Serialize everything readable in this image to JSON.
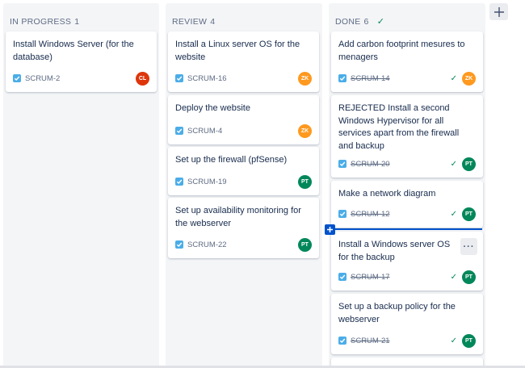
{
  "columns": [
    {
      "name": "IN PROGRESS",
      "count": "1",
      "done": false
    },
    {
      "name": "REVIEW",
      "count": "4",
      "done": false
    },
    {
      "name": "DONE",
      "count": "6",
      "done": true
    }
  ],
  "cards": {
    "inprogress": [
      {
        "title": "Install Windows Server (for the database)",
        "key": "SCRUM-2",
        "avatar": "CL",
        "avatar_color": "#de350b"
      }
    ],
    "review": [
      {
        "title": "Install a Linux server OS for the website",
        "key": "SCRUM-16",
        "avatar": "ZK",
        "avatar_color": "#ff991f"
      },
      {
        "title": "Deploy the website",
        "key": "SCRUM-4",
        "avatar": "ZK",
        "avatar_color": "#ff991f"
      },
      {
        "title": "Set up the firewall (pfSense)",
        "key": "SCRUM-19",
        "avatar": "PT",
        "avatar_color": "#00875a"
      },
      {
        "title": "Set up availability monitoring for the webserver",
        "key": "SCRUM-22",
        "avatar": "PT",
        "avatar_color": "#00875a"
      }
    ],
    "done": [
      {
        "title": "Add carbon footprint mesures to menagers",
        "key": "SCRUM-14",
        "avatar": "ZK",
        "avatar_color": "#ff991f"
      },
      {
        "title": "REJECTED Install a second Windows Hypervisor for all services apart from the firewall and backup",
        "key": "SCRUM-20",
        "avatar": "PT",
        "avatar_color": "#00875a"
      },
      {
        "title": "Make a network diagram",
        "key": "SCRUM-12",
        "avatar": "PT",
        "avatar_color": "#00875a"
      },
      {
        "title": "Install a Windows server OS for the backup",
        "key": "SCRUM-17",
        "avatar": "PT",
        "avatar_color": "#00875a"
      },
      {
        "title": "Set up a backup policy for the webserver",
        "key": "SCRUM-21",
        "avatar": "PT",
        "avatar_color": "#00875a"
      }
    ]
  },
  "icons": {
    "add_column": "plus-icon",
    "more": "more-actions-icon",
    "check": "checkmark-icon"
  }
}
